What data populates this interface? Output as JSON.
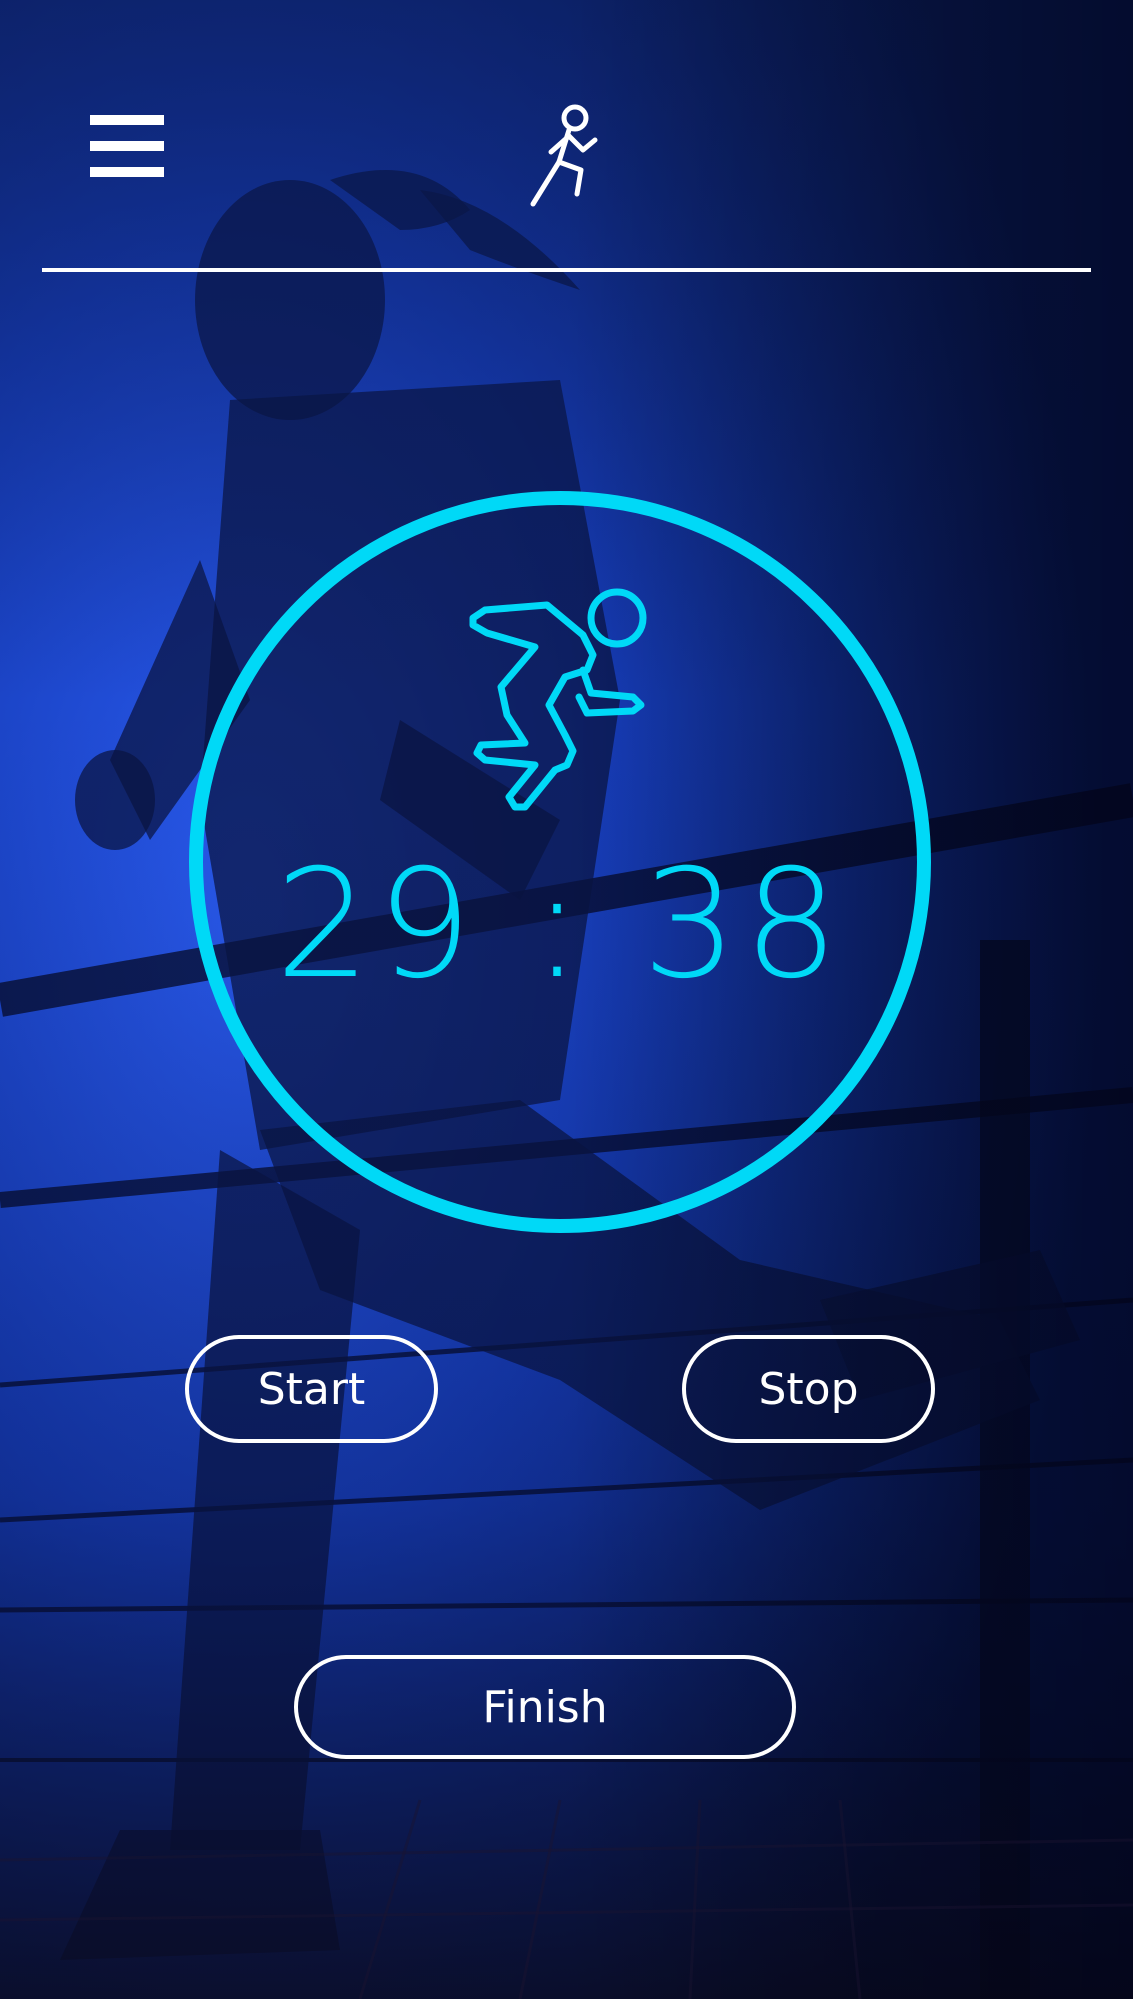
{
  "header": {
    "menu_icon": "hamburger-menu-icon",
    "logo_icon": "running-person-icon"
  },
  "timer": {
    "icon": "sprinting-runner-icon",
    "display": "29 : 38",
    "accent_color": "#00d9f7"
  },
  "controls": {
    "start_label": "Start",
    "stop_label": "Stop",
    "finish_label": "Finish"
  },
  "background": {
    "image": "runner-silhouette-photo",
    "tint_color": "#0d2a9a"
  }
}
